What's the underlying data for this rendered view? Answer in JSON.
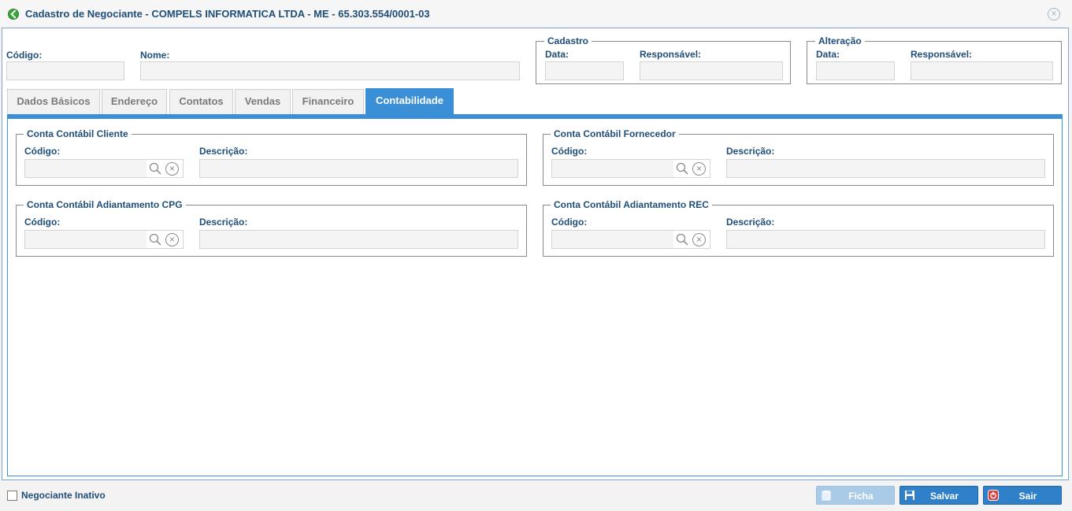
{
  "window": {
    "title": "Cadastro de Negociante - COMPELS INFORMATICA LTDA - ME - 65.303.554/0001-03"
  },
  "header": {
    "codigo_label": "Código:",
    "nome_label": "Nome:",
    "codigo_value": "",
    "nome_value": "",
    "cadastro": {
      "legend": "Cadastro",
      "data_label": "Data:",
      "responsavel_label": "Responsável:",
      "data_value": "",
      "responsavel_value": ""
    },
    "alteracao": {
      "legend": "Alteração",
      "data_label": "Data:",
      "responsavel_label": "Responsável:",
      "data_value": "",
      "responsavel_value": ""
    }
  },
  "tabs": [
    {
      "label": "Dados Básicos",
      "active": false
    },
    {
      "label": "Endereço",
      "active": false
    },
    {
      "label": "Contatos",
      "active": false
    },
    {
      "label": "Vendas",
      "active": false
    },
    {
      "label": "Financeiro",
      "active": false
    },
    {
      "label": "Contabilidade",
      "active": true
    }
  ],
  "contabilidade": {
    "groups": [
      {
        "legend": "Conta Contábil Cliente",
        "codigo_label": "Código:",
        "descricao_label": "Descrição:",
        "codigo_value": "",
        "descricao_value": ""
      },
      {
        "legend": "Conta Contábil Fornecedor",
        "codigo_label": "Código:",
        "descricao_label": "Descrição:",
        "codigo_value": "",
        "descricao_value": ""
      },
      {
        "legend": "Conta Contábil Adiantamento CPG",
        "codigo_label": "Código:",
        "descricao_label": "Descrição:",
        "codigo_value": "",
        "descricao_value": ""
      },
      {
        "legend": "Conta Contábil Adiantamento REC",
        "codigo_label": "Código:",
        "descricao_label": "Descrição:",
        "codigo_value": "",
        "descricao_value": ""
      }
    ]
  },
  "footer": {
    "inativo_label": "Negociante Inativo",
    "inativo_checked": false,
    "ficha_label": "Ficha",
    "salvar_label": "Salvar",
    "sair_label": "Sair"
  },
  "icons": {
    "title": "green-check-icon",
    "close": "close-circle-icon",
    "search": "magnifier-icon",
    "clear": "clear-circle-icon",
    "ficha": "clipboard-icon",
    "salvar": "floppy-disk-icon",
    "sair": "exit-icon"
  },
  "colors": {
    "accent": "#3a8fd6",
    "label": "#1f4e79",
    "button": "#2f7fc9",
    "button_disabled": "#a9cbe8"
  }
}
